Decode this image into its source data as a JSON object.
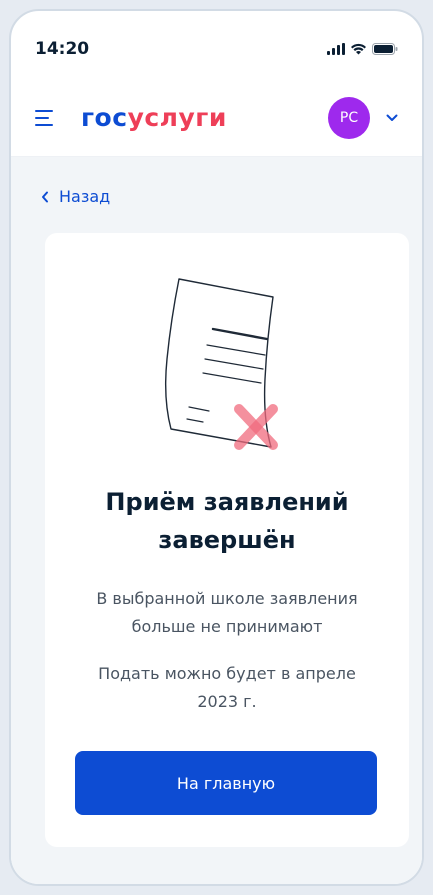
{
  "status_bar": {
    "time": "14:20",
    "icons": [
      "signal-icon",
      "wifi-icon",
      "battery-icon"
    ]
  },
  "header": {
    "logo_part1": "гос",
    "logo_part2": "услуги",
    "avatar_initials": "РС",
    "colors": {
      "brand_blue": "#0d4cd3",
      "brand_red": "#ee3f58",
      "avatar": "#9e29ed"
    }
  },
  "nav": {
    "back_label": "Назад"
  },
  "card": {
    "illustration": "rejected-document-icon",
    "title": "Приём заявлений завершён",
    "text_1": "В выбранной школе заявления больше не принимают",
    "text_2": "Подать можно будет в апреле 2023 г.",
    "button_label": "На главную"
  }
}
